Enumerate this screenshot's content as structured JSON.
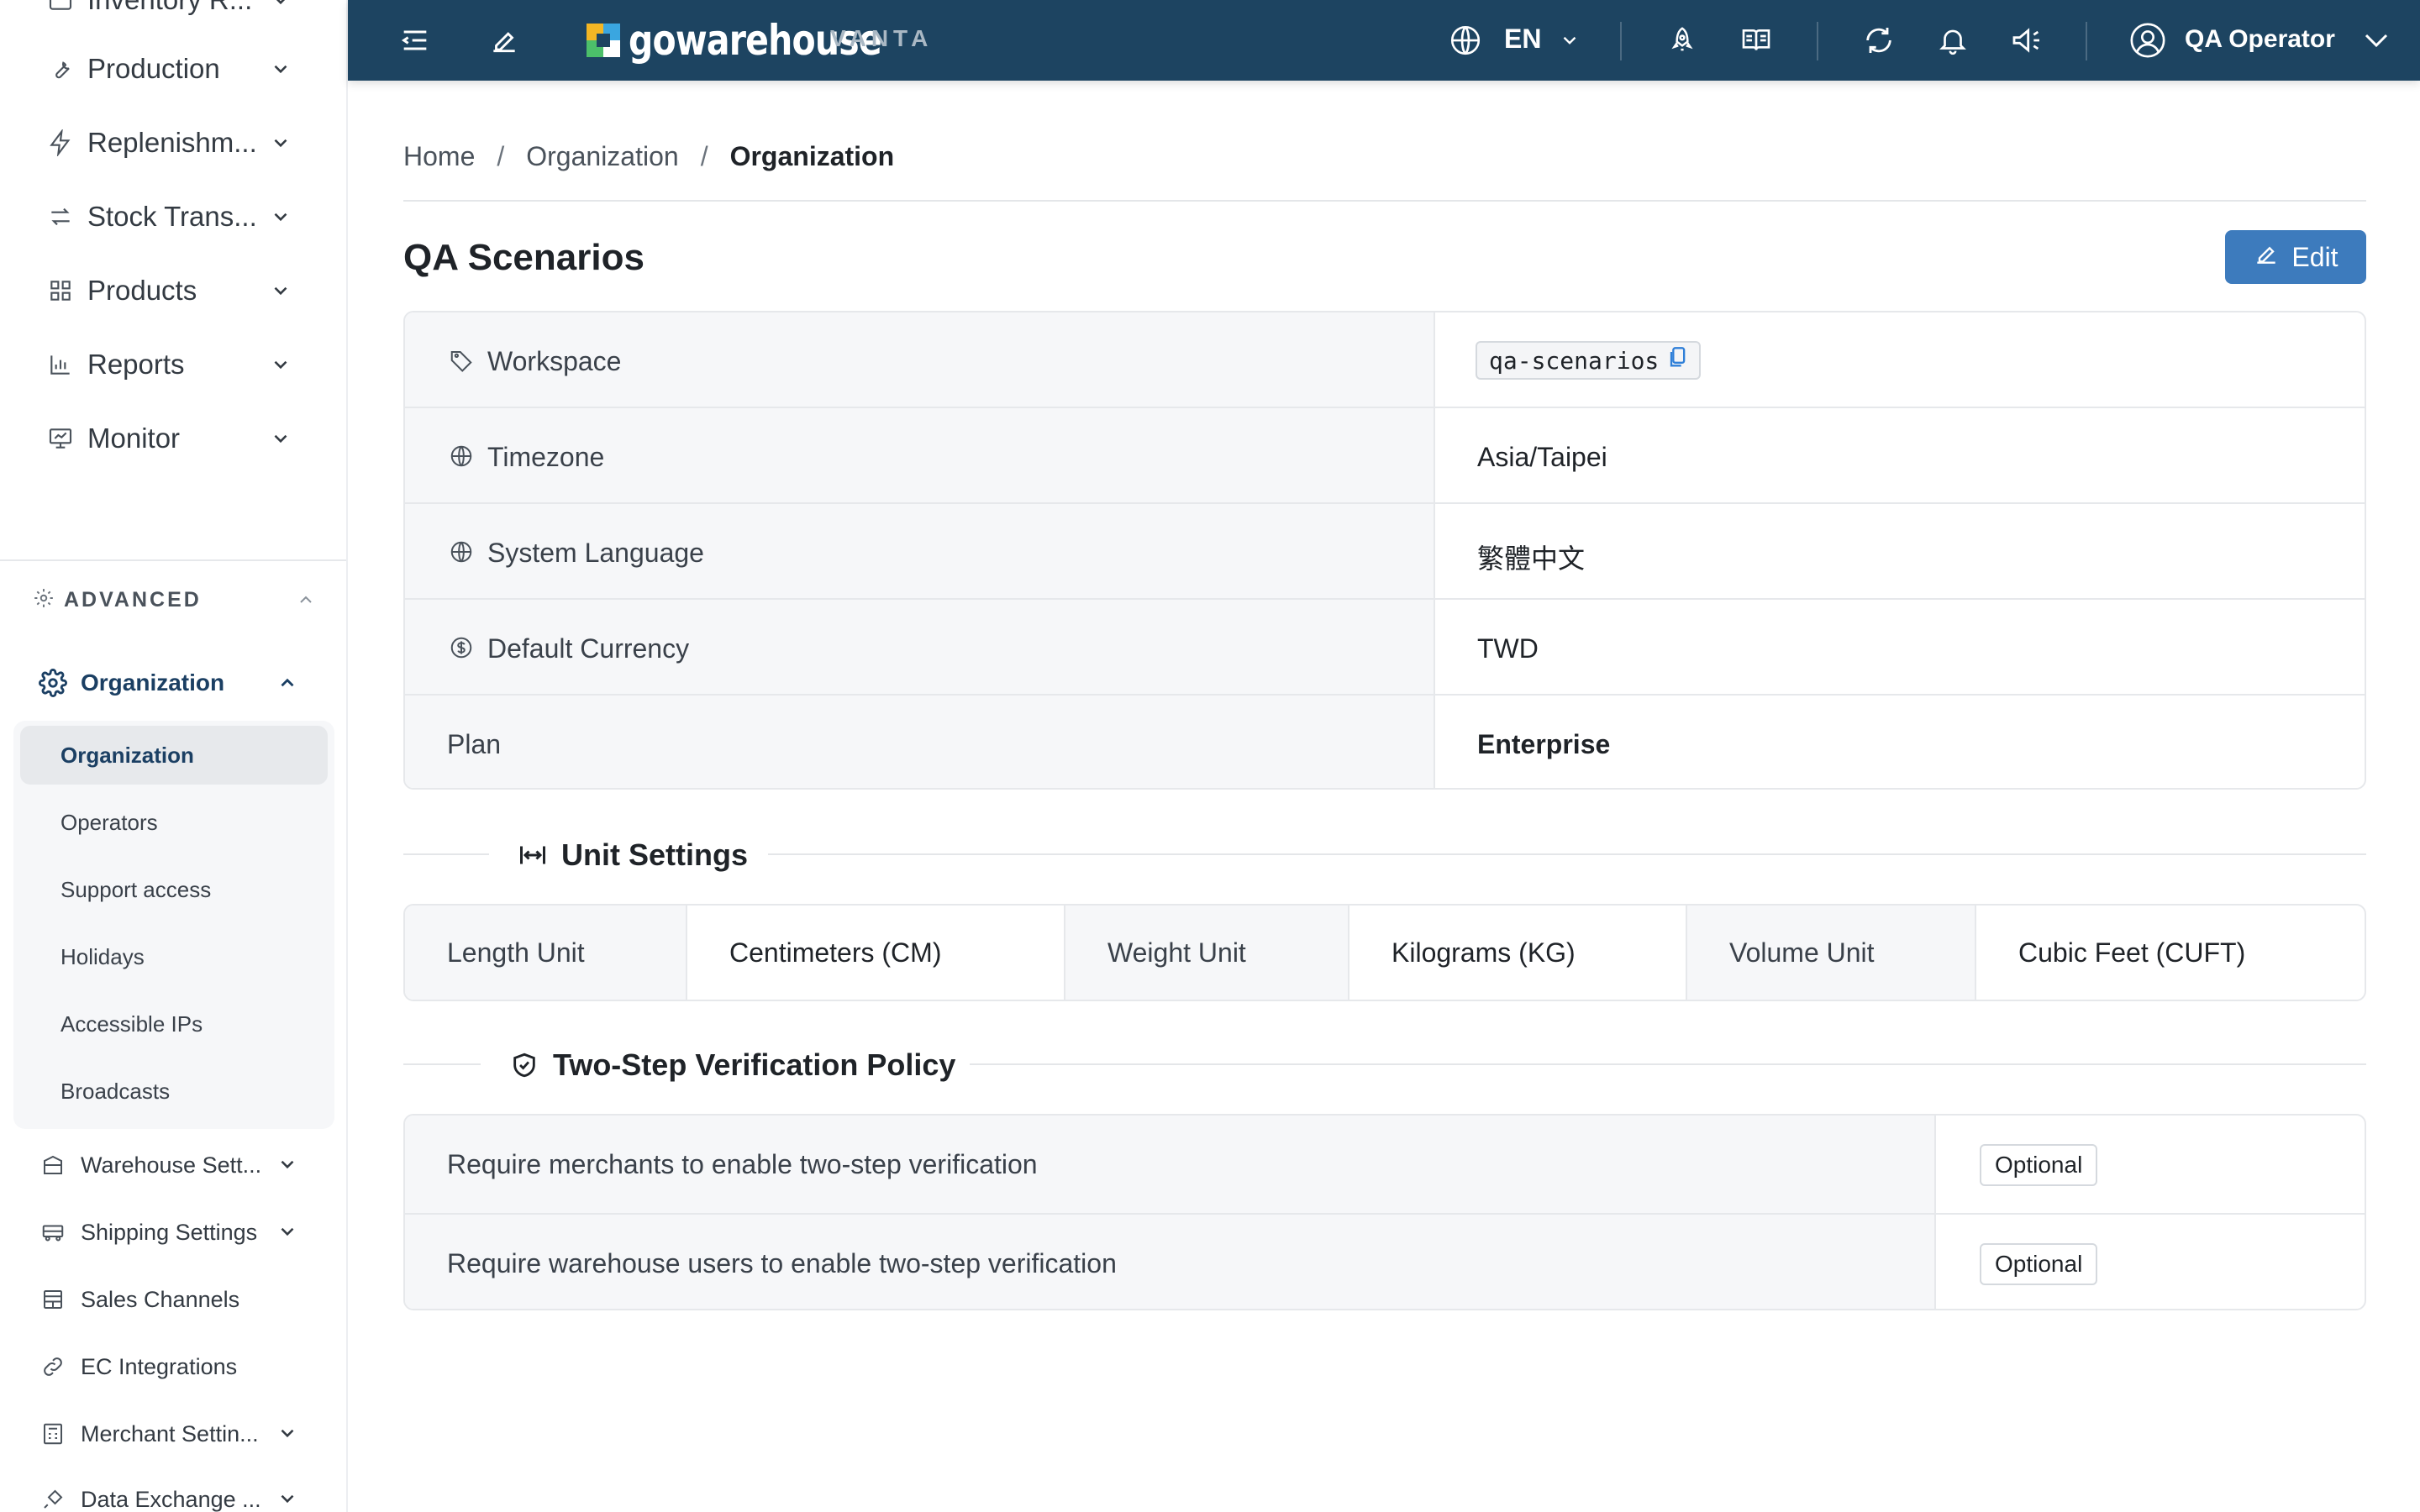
{
  "sidebar": {
    "top_items": [
      {
        "label": "Inventory R...",
        "icon": "inventory-icon"
      },
      {
        "label": "Production",
        "icon": "wrench-icon"
      },
      {
        "label": "Replenishm...",
        "icon": "lightning-icon"
      },
      {
        "label": "Stock Trans...",
        "icon": "transfer-arrows-icon"
      },
      {
        "label": "Products",
        "icon": "grid-icon"
      },
      {
        "label": "Reports",
        "icon": "bar-chart-icon"
      },
      {
        "label": "Monitor",
        "icon": "monitor-icon"
      }
    ],
    "advanced_label": "ADVANCED",
    "organization_group_label": "Organization",
    "sub_items": [
      "Organization",
      "Operators",
      "Support access",
      "Holidays",
      "Accessible IPs",
      "Broadcasts"
    ],
    "bottom_items": [
      {
        "label": "Warehouse Sett...",
        "icon": "warehouse-icon",
        "expandable": true
      },
      {
        "label": "Shipping Settings",
        "icon": "truck-icon",
        "expandable": true
      },
      {
        "label": "Sales Channels",
        "icon": "store-icon",
        "expandable": false
      },
      {
        "label": "EC Integrations",
        "icon": "link-icon",
        "expandable": false
      },
      {
        "label": "Merchant Settin...",
        "icon": "calculator-icon",
        "expandable": true
      },
      {
        "label": "Data Exchange ...",
        "icon": "plug-icon",
        "expandable": true
      }
    ]
  },
  "topbar": {
    "brand": "gowarehouse",
    "brand_sub": "VANTA",
    "language": "EN",
    "user_name": "QA Operator",
    "colors": {
      "bar": "#1d4461",
      "accent": "#3d7bbd"
    }
  },
  "breadcrumb": [
    "Home",
    "Organization",
    "Organization"
  ],
  "page": {
    "title": "QA Scenarios",
    "edit_label": "Edit"
  },
  "info": {
    "workspace_label": "Workspace",
    "workspace_value": "qa-scenarios",
    "timezone_label": "Timezone",
    "timezone_value": "Asia/Taipei",
    "language_label": "System Language",
    "language_value": "繁體中文",
    "currency_label": "Default Currency",
    "currency_value": "TWD",
    "plan_label": "Plan",
    "plan_value": "Enterprise"
  },
  "units": {
    "section_title": "Unit Settings",
    "length_label": "Length Unit",
    "length_value": "Centimeters (CM)",
    "weight_label": "Weight Unit",
    "weight_value": "Kilograms (KG)",
    "volume_label": "Volume Unit",
    "volume_value": "Cubic Feet (CUFT)"
  },
  "two_step": {
    "section_title": "Two-Step Verification Policy",
    "rows": [
      {
        "label": "Require merchants to enable two-step verification",
        "value": "Optional"
      },
      {
        "label": "Require warehouse users to enable two-step verification",
        "value": "Optional"
      }
    ]
  }
}
